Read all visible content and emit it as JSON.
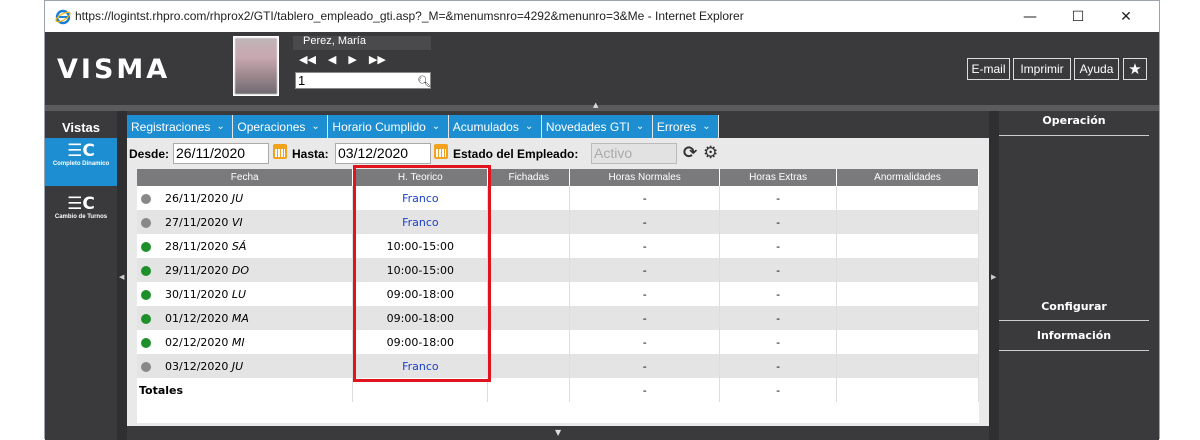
{
  "window": {
    "title": "https://logintst.rhpro.com/rhprox2/GTI/tablero_empleado_gti.asp?_M=&menumsnro=4292&menunro=3&Me - Internet Explorer",
    "minimize": "—",
    "maximize": "☐",
    "close": "✕"
  },
  "header": {
    "logo": "VISMA",
    "employee_name": "Perez, María",
    "employee_number": "1",
    "buttons": {
      "email": "E-mail",
      "print": "Imprimir",
      "help": "Ayuda"
    }
  },
  "sidebar": {
    "title": "Vistas",
    "items": [
      {
        "label": "Completo Dinamico",
        "selected": true
      },
      {
        "label": "Cambio de Turnos",
        "selected": false
      }
    ]
  },
  "tabs": [
    "Registraciones",
    "Operaciones",
    "Horario Cumplido",
    "Acumulados",
    "Novedades GTI",
    "Errores"
  ],
  "filters": {
    "desde_label": "Desde:",
    "desde_value": "26/11/2020",
    "hasta_label": "Hasta:",
    "hasta_value": "03/12/2020",
    "estado_label": "Estado del Empleado:",
    "estado_value": "Activo"
  },
  "table": {
    "columns": [
      "Fecha",
      "H. Teorico",
      "Fichadas",
      "Horas Normales",
      "Horas Extras",
      "Anormalidades"
    ],
    "rows": [
      {
        "status": "gray",
        "date": "26/11/2020",
        "day": "JU",
        "teorico": "Franco",
        "franco": true,
        "fichadas": "",
        "normales": "-",
        "extras": "-",
        "anormalidades": ""
      },
      {
        "status": "gray",
        "date": "27/11/2020",
        "day": "VI",
        "teorico": "Franco",
        "franco": true,
        "fichadas": "",
        "normales": "-",
        "extras": "-",
        "anormalidades": ""
      },
      {
        "status": "green",
        "date": "28/11/2020",
        "day": "SÁ",
        "teorico": "10:00-15:00",
        "franco": false,
        "fichadas": "",
        "normales": "-",
        "extras": "-",
        "anormalidades": ""
      },
      {
        "status": "green",
        "date": "29/11/2020",
        "day": "DO",
        "teorico": "10:00-15:00",
        "franco": false,
        "fichadas": "",
        "normales": "-",
        "extras": "-",
        "anormalidades": ""
      },
      {
        "status": "green",
        "date": "30/11/2020",
        "day": "LU",
        "teorico": "09:00-18:00",
        "franco": false,
        "fichadas": "",
        "normales": "-",
        "extras": "-",
        "anormalidades": ""
      },
      {
        "status": "green",
        "date": "01/12/2020",
        "day": "MA",
        "teorico": "09:00-18:00",
        "franco": false,
        "fichadas": "",
        "normales": "-",
        "extras": "-",
        "anormalidades": ""
      },
      {
        "status": "green",
        "date": "02/12/2020",
        "day": "MI",
        "teorico": "09:00-18:00",
        "franco": false,
        "fichadas": "",
        "normales": "-",
        "extras": "-",
        "anormalidades": ""
      },
      {
        "status": "gray",
        "date": "03/12/2020",
        "day": "JU",
        "teorico": "Franco",
        "franco": true,
        "fichadas": "",
        "normales": "-",
        "extras": "-",
        "anormalidades": ""
      }
    ],
    "totals": {
      "label": "Totales",
      "normales": "-",
      "extras": "-"
    }
  },
  "right_panel": {
    "operacion": "Operación",
    "configurar": "Configurar",
    "informacion": "Información"
  },
  "colors": {
    "tab_blue": "#1c8ed1",
    "highlight_red": "#e0141e",
    "status_green": "#1e8f2a",
    "status_gray": "#888888",
    "franco_blue": "#1a3fc8"
  }
}
